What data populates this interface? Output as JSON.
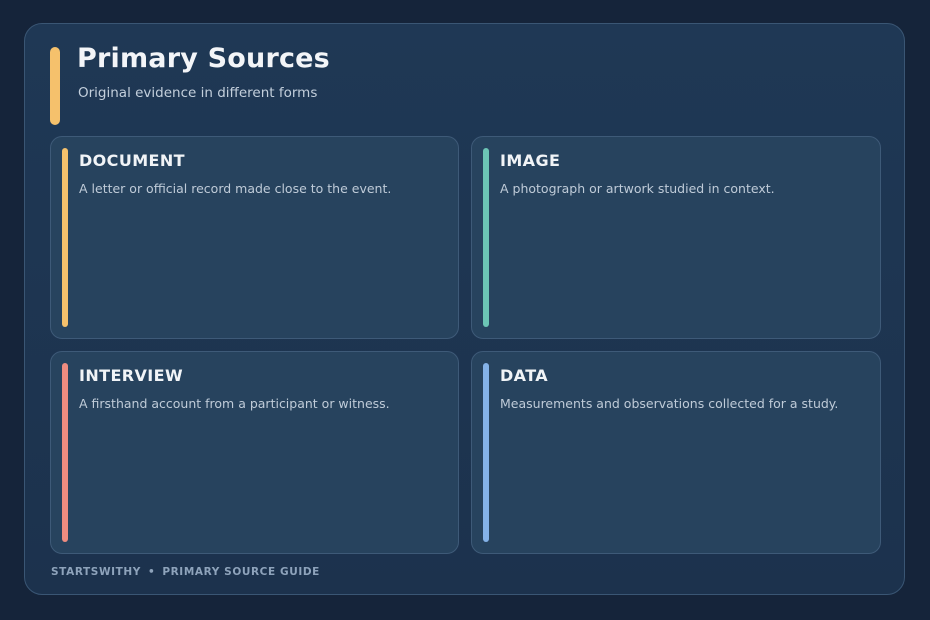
{
  "header": {
    "title": "Primary Sources",
    "subtitle": "Original evidence in different forms",
    "accent_color": "#f5c16c"
  },
  "cards": [
    {
      "title": "DOCUMENT",
      "text": "A letter or official record made close to the event.",
      "accent_color": "#f5c16c"
    },
    {
      "title": "IMAGE",
      "text": "A photograph or artwork studied in context.",
      "accent_color": "#6cc5b5"
    },
    {
      "title": "INTERVIEW",
      "text": "A firsthand account from a participant or witness.",
      "accent_color": "#ef8c80"
    },
    {
      "title": "DATA",
      "text": "Measurements and observations collected for a study.",
      "accent_color": "#84b2e8"
    }
  ],
  "footer": {
    "brand": "STARTSWITHY",
    "separator": "•",
    "label": "PRIMARY SOURCE GUIDE"
  }
}
